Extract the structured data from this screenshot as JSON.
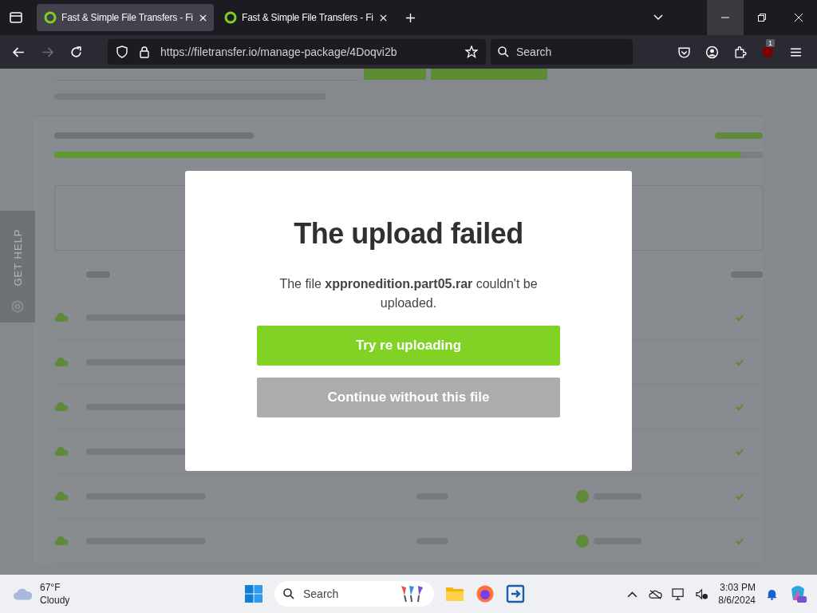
{
  "browser": {
    "tabs": [
      {
        "title": "Fast & Simple File Transfers - Fi",
        "selected": true
      },
      {
        "title": "Fast & Simple File Transfers - Fi",
        "selected": false
      }
    ],
    "url": "https://filetransfer.io/manage-package/4Doqvi2b",
    "search": {
      "placeholder": "Search"
    },
    "extension_badge": "1"
  },
  "page": {
    "help_tab": "GET HELP",
    "upload_progress": {
      "level": 0.97
    }
  },
  "modal": {
    "title": "The upload failed",
    "message": "The file **xppronedition.part05.rar** couldn't be uploaded.",
    "buttons": [
      {
        "label": "Try re uploading",
        "kind": "primary"
      },
      {
        "label": "Continue without this file",
        "kind": "secondary"
      }
    ]
  },
  "taskbar": {
    "weather": {
      "temperature": "67°F",
      "condition": "Cloudy"
    },
    "search": {
      "placeholder": "Search"
    },
    "time": "3:03 PM",
    "date": "8/6/2024"
  }
}
